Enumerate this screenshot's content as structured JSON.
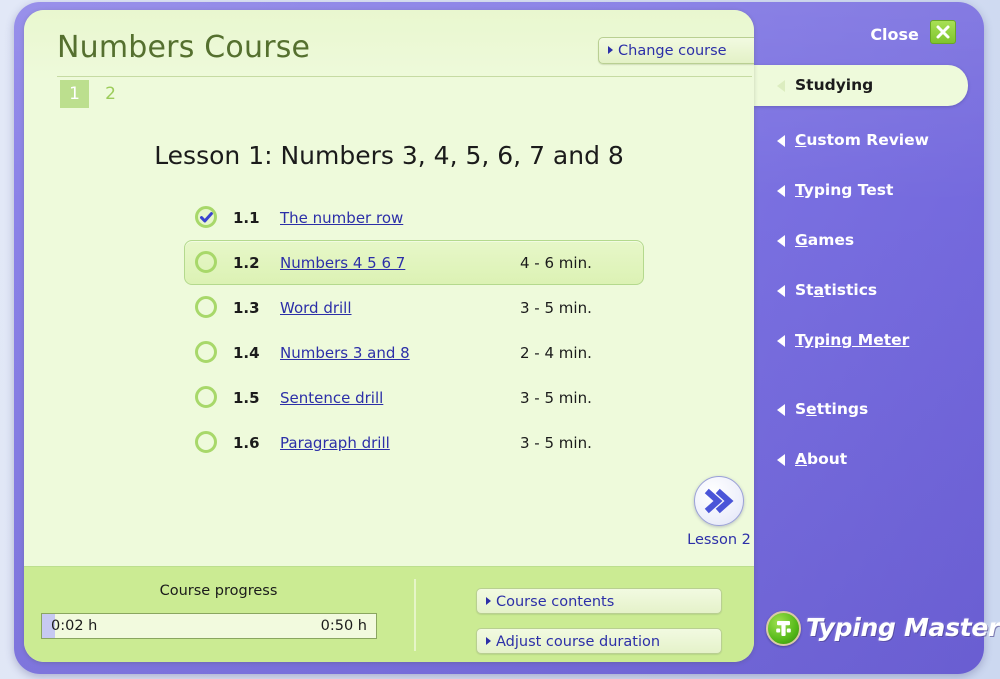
{
  "window": {
    "close_label": "Close",
    "close_icon": "close-x-icon"
  },
  "header": {
    "course_title": "Numbers Course",
    "change_course_label": "Change course",
    "lesson_tabs": [
      {
        "label": "1",
        "active": true
      },
      {
        "label": "2",
        "active": false
      }
    ]
  },
  "main": {
    "lesson_heading": "Lesson 1: Numbers 3, 4, 5, 6, 7 and 8",
    "lessons": [
      {
        "num": "1.1",
        "name": "The number row",
        "time": "",
        "status": "done",
        "current": false
      },
      {
        "num": "1.2",
        "name": "Numbers 4 5 6 7",
        "time": "4 - 6 min.",
        "status": "todo",
        "current": true
      },
      {
        "num": "1.3",
        "name": "Word drill",
        "time": "3 - 5 min.",
        "status": "todo",
        "current": false
      },
      {
        "num": "1.4",
        "name": "Numbers 3 and 8",
        "time": "2 - 4 min.",
        "status": "todo",
        "current": false
      },
      {
        "num": "1.5",
        "name": "Sentence drill",
        "time": "3 - 5 min.",
        "status": "todo",
        "current": false
      },
      {
        "num": "1.6",
        "name": "Paragraph drill",
        "time": "3 - 5 min.",
        "status": "todo",
        "current": false
      }
    ],
    "next_lesson_label": "Lesson 2",
    "next_lesson_icon": "double-chevron-right-icon"
  },
  "footer": {
    "progress_label": "Course progress",
    "progress_elapsed": "0:02 h",
    "progress_total": "0:50 h",
    "progress_percent": 4,
    "buttons": [
      {
        "label": "Course contents"
      },
      {
        "label": "Adjust course duration"
      }
    ]
  },
  "sidebar": {
    "items": [
      {
        "label": "Studying",
        "mnemonic": "",
        "active": true,
        "hovered": false
      },
      {
        "label": "Custom Review",
        "mnemonic": "C",
        "active": false,
        "hovered": false
      },
      {
        "label": "Typing Test",
        "mnemonic": "T",
        "active": false,
        "hovered": false
      },
      {
        "label": "Games",
        "mnemonic": "G",
        "active": false,
        "hovered": false
      },
      {
        "label": "Statistics",
        "mnemonic": "a",
        "active": false,
        "hovered": false
      },
      {
        "label": "Typing Meter",
        "mnemonic": "T",
        "active": false,
        "hovered": true
      },
      {
        "label": "Settings",
        "mnemonic": "e",
        "active": false,
        "hovered": false
      },
      {
        "label": "About",
        "mnemonic": "A",
        "active": false,
        "hovered": false
      }
    ],
    "brand_name": "Typing Master",
    "brand_icon": "typing-master-logo-icon"
  },
  "colors": {
    "frame_purple": "#8077e4",
    "panel_green": "#eefadb",
    "footer_green": "#cbeb93",
    "link_blue": "#2c2fa8",
    "title_green": "#55702f",
    "accent_green": "#a8d86a"
  }
}
